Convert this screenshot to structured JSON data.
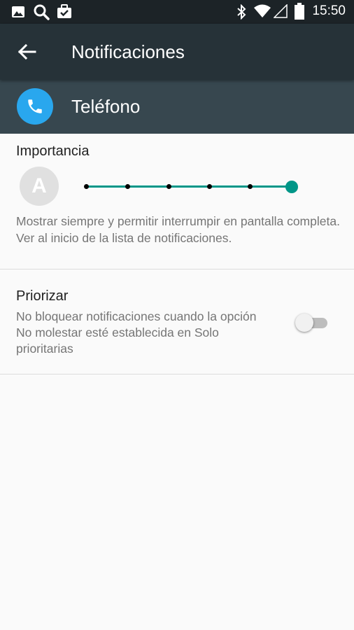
{
  "status_bar": {
    "time": "15:50",
    "icons": [
      "image-icon",
      "search-icon",
      "briefcase-icon",
      "bluetooth-icon",
      "wifi-icon",
      "cell-signal-icon",
      "battery-icon"
    ]
  },
  "app_bar": {
    "title": "Notificaciones",
    "back_icon": "back-arrow-icon"
  },
  "app_header": {
    "name": "Teléfono",
    "icon": "phone-icon",
    "icon_color": "#29a7ee"
  },
  "importance": {
    "title": "Importancia",
    "avatar_letter": "A",
    "level": 5,
    "max_level": 5,
    "description": "Mostrar siempre y permitir interrumpir en pantalla completa. Ver al inicio de la lista de notificaciones."
  },
  "priority": {
    "title": "Priorizar",
    "description": "No bloquear notificaciones cuando la opción No molestar esté establecida en Solo prioritarias",
    "enabled": false
  },
  "colors": {
    "accent": "#009688",
    "app_bar": "#263238",
    "app_header": "#37474f"
  }
}
